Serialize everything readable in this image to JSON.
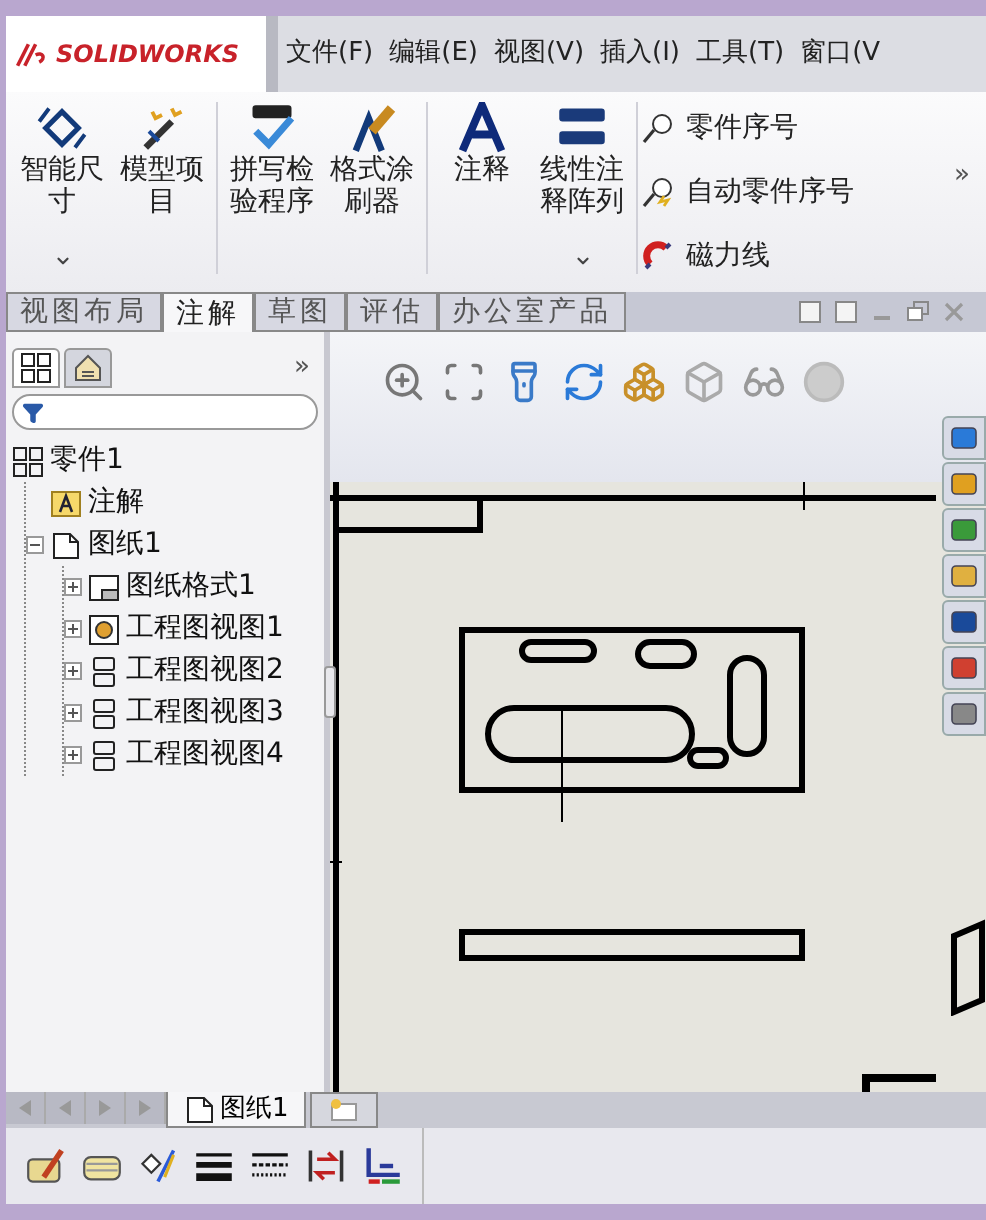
{
  "app": {
    "logo": "SOLIDWORKS"
  },
  "menu": [
    "文件(F)",
    "编辑(E)",
    "视图(V)",
    "插入(I)",
    "工具(T)",
    "窗口(V"
  ],
  "ribbon": {
    "groups": [
      [
        {
          "label": "智能尺寸",
          "kind": "dimension",
          "has_menu": true
        },
        {
          "label": "模型项目",
          "kind": "wand",
          "has_menu": false
        }
      ],
      [
        {
          "label": "拼写检验程序",
          "kind": "spell",
          "has_menu": false
        },
        {
          "label": "格式涂刷器",
          "kind": "brush",
          "has_menu": false
        }
      ],
      [
        {
          "label": "注释",
          "kind": "note",
          "has_menu": false
        },
        {
          "label": "线性注释阵列",
          "kind": "pattern",
          "has_menu": true
        }
      ]
    ],
    "small": [
      {
        "label": "零件序号",
        "kind": "balloon"
      },
      {
        "label": "自动零件序号",
        "kind": "auto"
      },
      {
        "label": "磁力线",
        "kind": "magnet"
      }
    ],
    "more": "»"
  },
  "tabs": [
    {
      "label": "视图布局",
      "selected": false
    },
    {
      "label": "注解",
      "selected": true
    },
    {
      "label": "草图",
      "selected": false
    },
    {
      "label": "评估",
      "selected": false
    },
    {
      "label": "办公室产品",
      "selected": false
    }
  ],
  "panel": {
    "tabs": [
      {
        "kind": "tree",
        "selected": true
      },
      {
        "kind": "property",
        "selected": false
      }
    ],
    "more": "»",
    "tree": [
      {
        "label": "零件1",
        "kind": "part",
        "children": [
          {
            "label": "注解",
            "kind": "annotation"
          },
          {
            "label": "图纸1",
            "kind": "sheet",
            "expanded": true,
            "children": [
              {
                "label": "图纸格式1",
                "kind": "format",
                "expanded": false
              },
              {
                "label": "工程图视图1",
                "kind": "model",
                "expanded": false
              },
              {
                "label": "工程图视图2",
                "kind": "view",
                "expanded": false
              },
              {
                "label": "工程图视图3",
                "kind": "view",
                "expanded": false
              },
              {
                "label": "工程图视图4",
                "kind": "view",
                "expanded": false
              }
            ]
          }
        ]
      }
    ]
  },
  "sheet_tabs": [
    {
      "label": "图纸1",
      "kind": "sheet",
      "selected": true
    },
    {
      "kind": "add",
      "selected": false
    }
  ]
}
